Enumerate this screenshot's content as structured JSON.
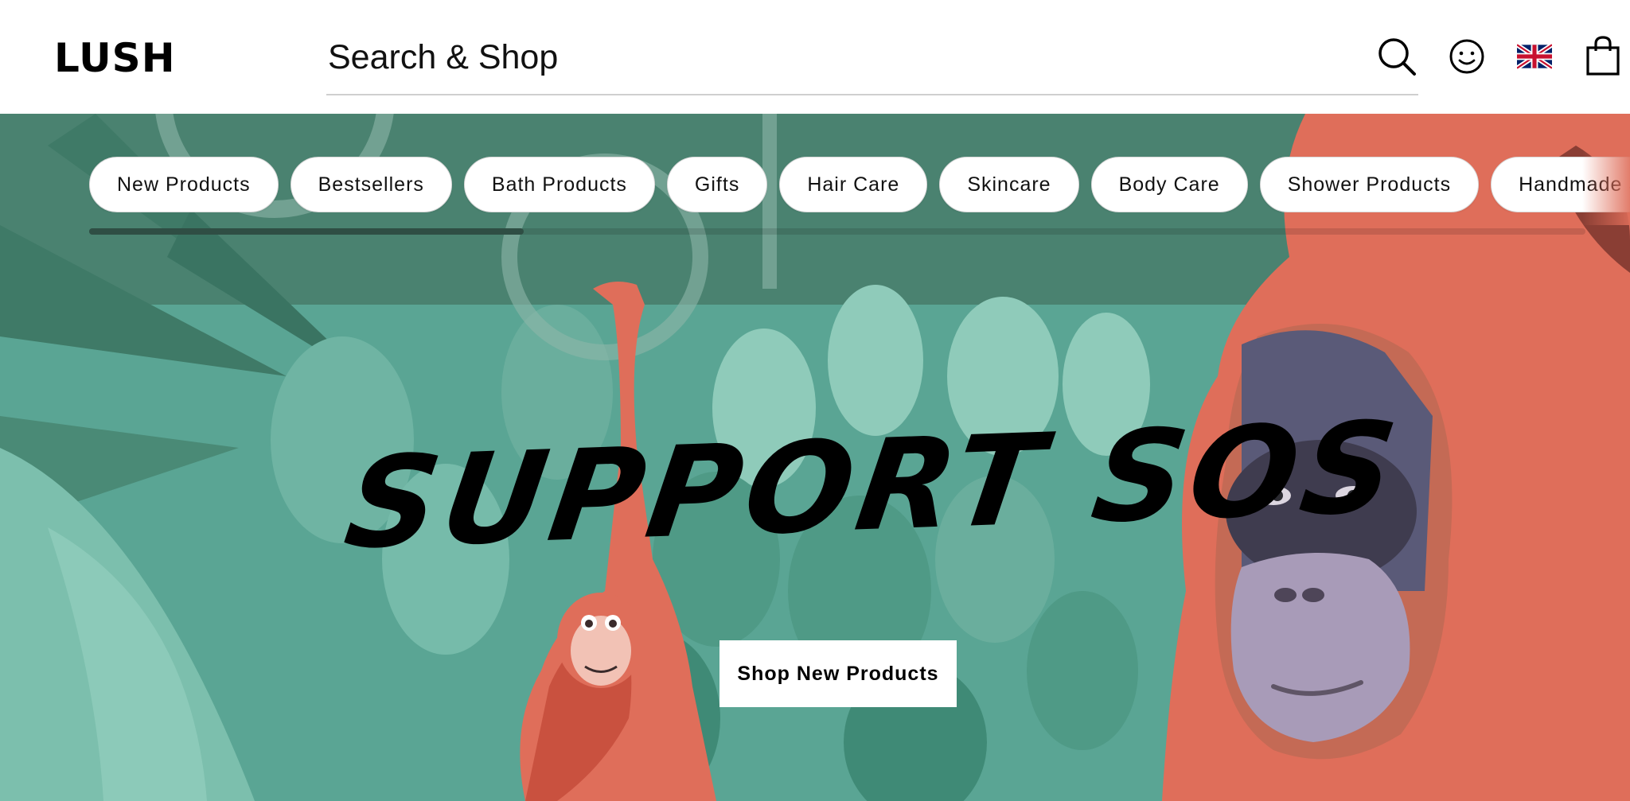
{
  "header": {
    "logo": "LUSH",
    "search_placeholder": "Search & Shop",
    "icons": [
      "search-icon",
      "account-icon",
      "uk-flag-icon",
      "shopping-bag-icon"
    ]
  },
  "categories": [
    "New Products",
    "Bestsellers",
    "Bath Products",
    "Gifts",
    "Hair Care",
    "Skincare",
    "Body Care",
    "Shower Products",
    "Handmade S"
  ],
  "hero": {
    "headline": "SUPPORT SOS",
    "cta_label": "Shop New Products"
  },
  "colors": {
    "jungle_teal": "#5aa594",
    "dark_green": "#4a8270",
    "orangutan_orange": "#df6e5a",
    "scroll_thumb": "#2f4e44"
  }
}
